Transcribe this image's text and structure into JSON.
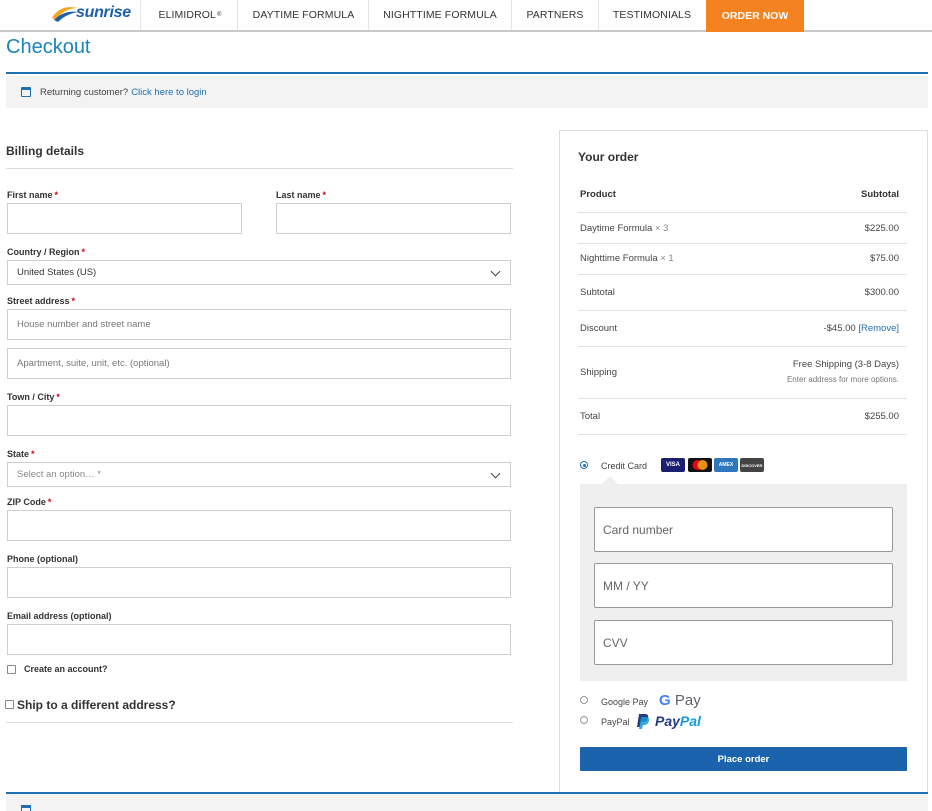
{
  "nav": {
    "logo_text": "sunrise",
    "items": [
      {
        "label": "ELIMIDROL",
        "sup": "®"
      },
      {
        "label": "DAYTIME FORMULA"
      },
      {
        "label": "NIGHTTIME FORMULA"
      },
      {
        "label": "PARTNERS"
      },
      {
        "label": "TESTIMONIALS"
      }
    ],
    "cta_label": "ORDER NOW",
    "cta_color": "#f58220"
  },
  "page": {
    "title": "Checkout",
    "returning_text": "Returning customer?",
    "returning_link": "Click here to login"
  },
  "billing": {
    "title": "Billing details",
    "first_name_label": "First name",
    "last_name_label": "Last name",
    "country_label": "Country / Region",
    "country_value": "United States (US)",
    "street_label": "Street address",
    "street_placeholder": "House number and street name",
    "street2_placeholder": "Apartment, suite, unit, etc. (optional)",
    "city_label": "Town / City",
    "state_label": "State",
    "state_placeholder": "Select an option… *",
    "zip_label": "ZIP Code",
    "phone_label": "Phone (optional)",
    "email_label": "Email address (optional)",
    "create_account_label": "Create an account?",
    "ship_different_label": "Ship to a different address?",
    "required_mark": "*"
  },
  "order": {
    "title": "Your order",
    "col_product": "Product",
    "col_subtotal": "Subtotal",
    "items": [
      {
        "name": "Daytime Formula",
        "qty": "× 3",
        "price": "$225.00"
      },
      {
        "name": "Nighttime Formula",
        "qty": "× 1",
        "price": "$75.00"
      }
    ],
    "subtotal_label": "Subtotal",
    "subtotal_value": "$300.00",
    "discount_label": "Discount",
    "discount_value": "-$45.00",
    "discount_remove": "[Remove]",
    "shipping_label": "Shipping",
    "shipping_value": "Free Shipping (3-8 Days)",
    "shipping_note": "Enter address for more options.",
    "total_label": "Total",
    "total_value": "$255.00"
  },
  "payment": {
    "credit_card_label": "Credit Card",
    "card_logos": [
      "VISA",
      "MasterCard",
      "AMEX",
      "DISCOVER"
    ],
    "card_number_placeholder": "Card number",
    "expiry_placeholder": "MM / YY",
    "cvv_placeholder": "CVV",
    "gpay_label": "Google Pay",
    "gpay_logo_g": "G",
    "gpay_logo_pay": "Pay",
    "paypal_label": "PayPal",
    "paypal_logo_pay": "Pay",
    "paypal_logo_pal": "Pal",
    "selected": "credit_card",
    "place_order_label": "Place order",
    "accent_color": "#1b64ad"
  }
}
